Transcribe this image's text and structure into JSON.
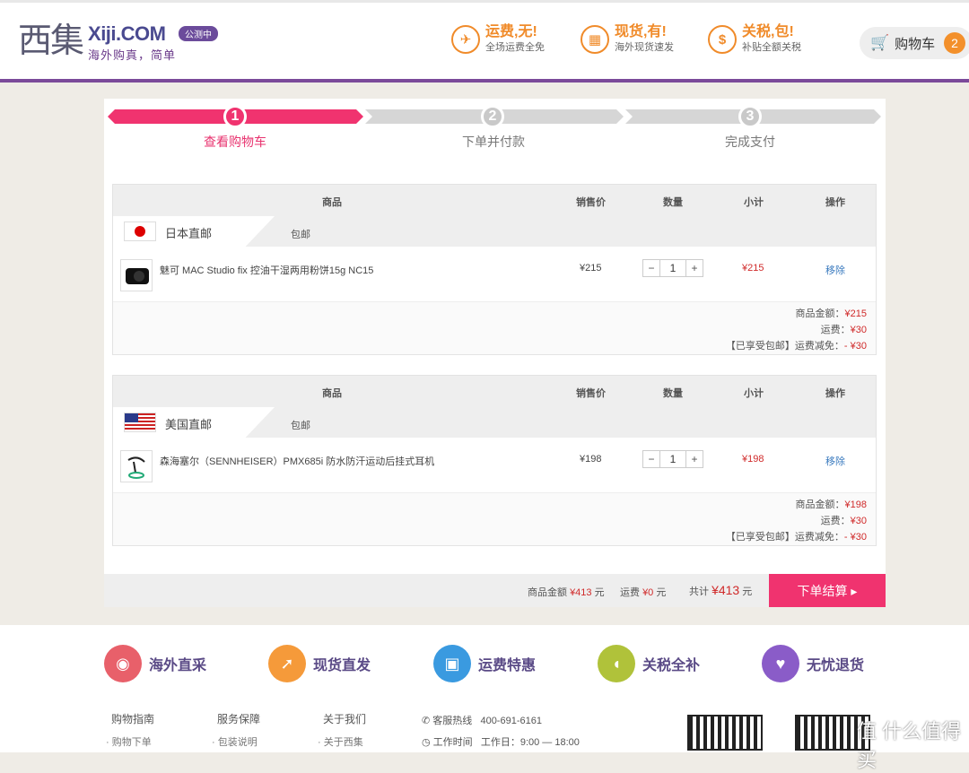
{
  "header": {
    "logo_cn": "西集",
    "logo_en": "Xiji.COM",
    "slogan": "海外购真，简单",
    "beta_badge": "公测中",
    "promos": [
      {
        "title": "运费,无!",
        "subtitle": "全场运费全免",
        "icon": "plane-icon"
      },
      {
        "title": "现货,有!",
        "subtitle": "海外现货速发",
        "icon": "gift-icon"
      },
      {
        "title": "关税,包!",
        "subtitle": "补贴全额关税",
        "icon": "money-face-icon"
      }
    ],
    "cart_label": "购物车",
    "cart_count": "2"
  },
  "steps": [
    {
      "num": "1",
      "label": "查看购物车",
      "active": true
    },
    {
      "num": "2",
      "label": "下单并付款",
      "active": false
    },
    {
      "num": "3",
      "label": "完成支付",
      "active": false
    }
  ],
  "table_headers": {
    "product": "商品",
    "price": "销售价",
    "qty": "数量",
    "subtotal": "小计",
    "action": "操作"
  },
  "groups": [
    {
      "ship_from": "日本直邮",
      "flag": "japan-flag-icon",
      "free_shipping": "包邮",
      "item": {
        "name": "魅可 MAC Studio fix 控油干湿两用粉饼15g NC15",
        "price": "¥215",
        "qty": "1",
        "subtotal": "¥215",
        "remove": "移除"
      },
      "sum_goods_label": "商品金额：",
      "sum_goods": "¥215",
      "sum_ship_label": "运费：",
      "sum_ship": "¥30",
      "sum_discount_label": "【已享受包邮】运费减免：",
      "sum_discount": "- ¥30"
    },
    {
      "ship_from": "美国直邮",
      "flag": "usa-flag-icon",
      "free_shipping": "包邮",
      "item": {
        "name": "森海塞尔（SENNHEISER）PMX685i 防水防汗运动后挂式耳机",
        "price": "¥198",
        "qty": "1",
        "subtotal": "¥198",
        "remove": "移除"
      },
      "sum_goods_label": "商品金额：",
      "sum_goods": "¥198",
      "sum_ship_label": "运费：",
      "sum_ship": "¥30",
      "sum_discount_label": "【已享受包邮】运费减免：",
      "sum_discount": "- ¥30"
    }
  ],
  "footer_bar": {
    "goods_label": "商品金额",
    "goods_value": "¥413",
    "goods_unit": "元",
    "ship_label": "运费",
    "ship_value": "¥0",
    "ship_unit": "元",
    "total_label": "共计",
    "total_value": "¥413",
    "total_unit": "元",
    "checkout": "下单结算 ▸"
  },
  "features": [
    {
      "label": "海外直采",
      "color": "#e8606a"
    },
    {
      "label": "现货直发",
      "color": "#f59a3a"
    },
    {
      "label": "运费特惠",
      "color": "#3a9ae0"
    },
    {
      "label": "关税全补",
      "color": "#b0c23a"
    },
    {
      "label": "无忧退货",
      "color": "#8a5cc8"
    }
  ],
  "footer": {
    "cols": [
      {
        "title": "购物指南",
        "sub": "· 购物下单"
      },
      {
        "title": "服务保障",
        "sub": "· 包装说明"
      },
      {
        "title": "关于我们",
        "sub": "· 关于西集"
      }
    ],
    "hotline_label": "客服热线",
    "hotline": "400-691-6161",
    "worktime_label": "工作时间",
    "worktime": "工作日：9:00 — 18:00"
  },
  "watermark": "值 什么值得买"
}
